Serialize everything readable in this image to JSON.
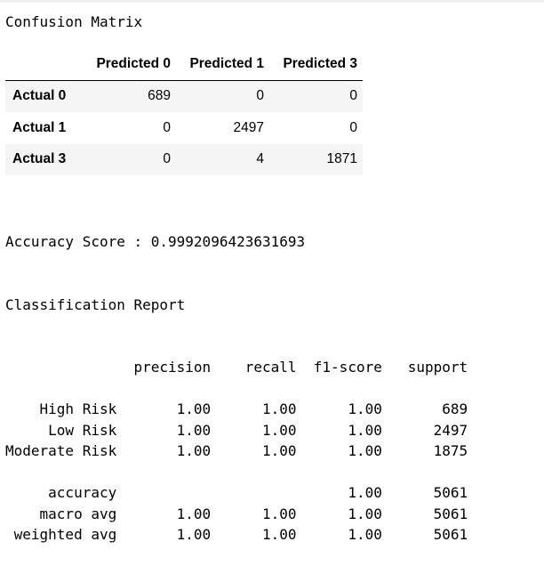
{
  "confusion_matrix": {
    "title": "Confusion Matrix",
    "columns": [
      "Predicted 0",
      "Predicted 1",
      "Predicted 3"
    ],
    "rows": [
      {
        "label": "Actual 0",
        "values": [
          "689",
          "0",
          "0"
        ]
      },
      {
        "label": "Actual 1",
        "values": [
          "0",
          "2497",
          "0"
        ]
      },
      {
        "label": "Actual 3",
        "values": [
          "0",
          "4",
          "1871"
        ]
      }
    ]
  },
  "accuracy_line": "Accuracy Score : 0.9992096423631693",
  "report": {
    "title": "Classification Report",
    "headers": [
      "precision",
      "recall",
      "f1-score",
      "support"
    ],
    "class_rows": [
      {
        "label": "High Risk",
        "precision": "1.00",
        "recall": "1.00",
        "f1": "1.00",
        "support": "689"
      },
      {
        "label": "Low Risk",
        "precision": "1.00",
        "recall": "1.00",
        "f1": "1.00",
        "support": "2497"
      },
      {
        "label": "Moderate Risk",
        "precision": "1.00",
        "recall": "1.00",
        "f1": "1.00",
        "support": "1875"
      }
    ],
    "summary_rows": [
      {
        "label": "accuracy",
        "precision": "",
        "recall": "",
        "f1": "1.00",
        "support": "5061"
      },
      {
        "label": "macro avg",
        "precision": "1.00",
        "recall": "1.00",
        "f1": "1.00",
        "support": "5061"
      },
      {
        "label": "weighted avg",
        "precision": "1.00",
        "recall": "1.00",
        "f1": "1.00",
        "support": "5061"
      }
    ]
  }
}
